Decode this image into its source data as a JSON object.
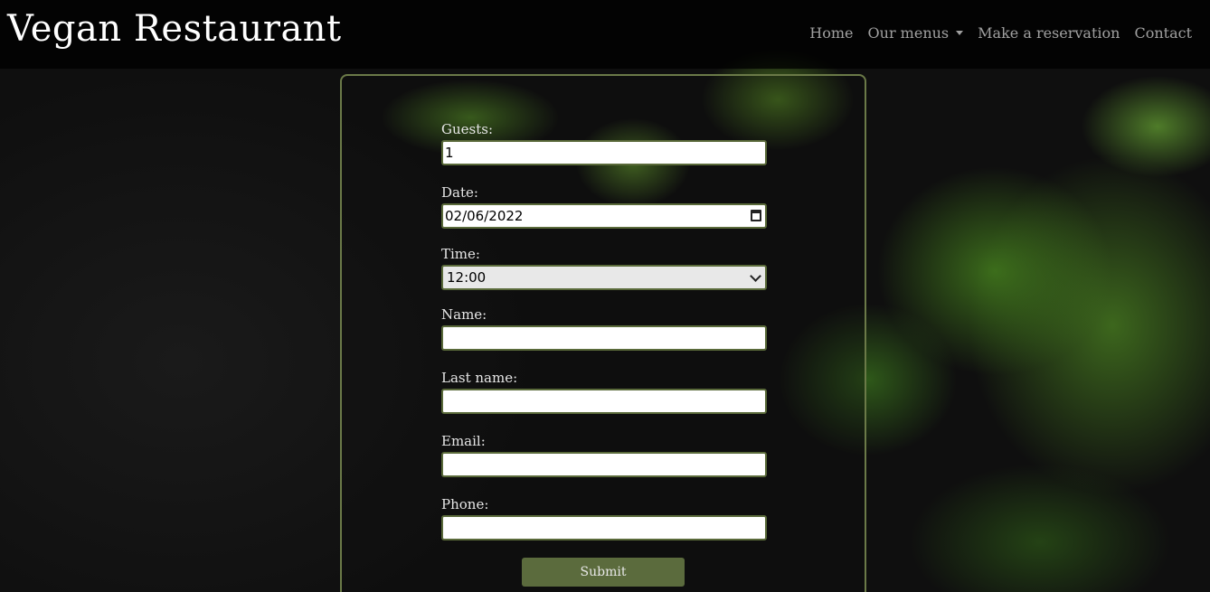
{
  "brand": "Vegan Restaurant",
  "nav": {
    "home": "Home",
    "menus": "Our menus",
    "reservation": "Make a reservation",
    "contact": "Contact"
  },
  "form": {
    "guests_label": "Guests:",
    "guests_value": "1",
    "date_label": "Date:",
    "date_value": "02/06/2022",
    "time_label": "Time:",
    "time_value": "12:00",
    "name_label": "Name:",
    "name_value": "",
    "lastname_label": "Last name:",
    "lastname_value": "",
    "email_label": "Email:",
    "email_value": "",
    "phone_label": "Phone:",
    "phone_value": "",
    "submit_label": "Submit"
  },
  "colors": {
    "accent": "#5b6b3d",
    "border": "#6b7a48",
    "navbar": "#000000"
  }
}
